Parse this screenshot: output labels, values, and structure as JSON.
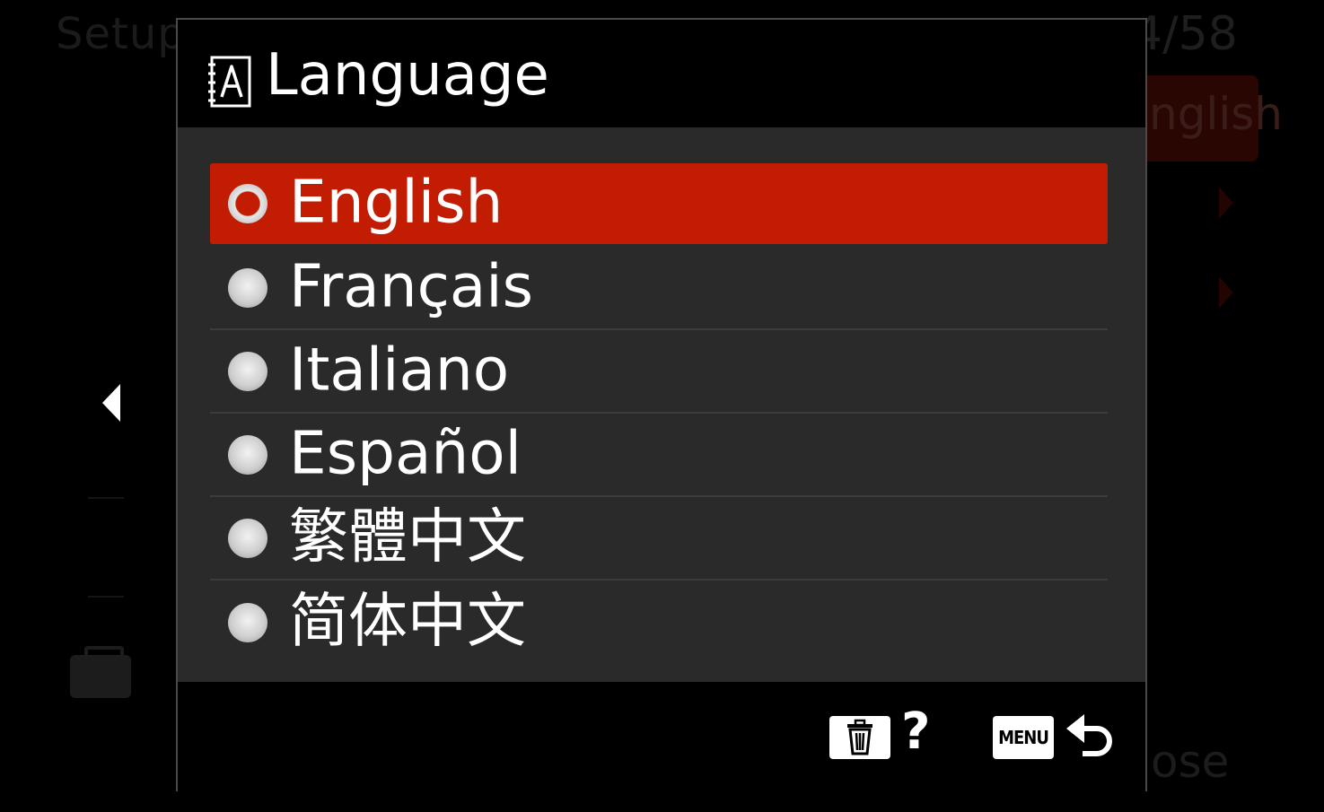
{
  "background": {
    "title": "Setup",
    "page_indicator": "4/58",
    "current_value": "nglish",
    "close_label": "ose"
  },
  "dialog": {
    "title": "Language",
    "icon": "language-book-icon",
    "options": [
      {
        "label": "English",
        "selected": true
      },
      {
        "label": "Français",
        "selected": false
      },
      {
        "label": "Italiano",
        "selected": false
      },
      {
        "label": "Español",
        "selected": false
      },
      {
        "label": "繁體中文",
        "selected": false
      },
      {
        "label": "简体中文",
        "selected": false
      }
    ],
    "footer": {
      "trash_icon": "trash-icon",
      "help_label": "?",
      "menu_label": "MENU",
      "back_icon": "return-arrow-icon"
    }
  },
  "colors": {
    "selection": "#c21d03",
    "list_background": "#2a2a2a",
    "text": "#ffffff"
  }
}
